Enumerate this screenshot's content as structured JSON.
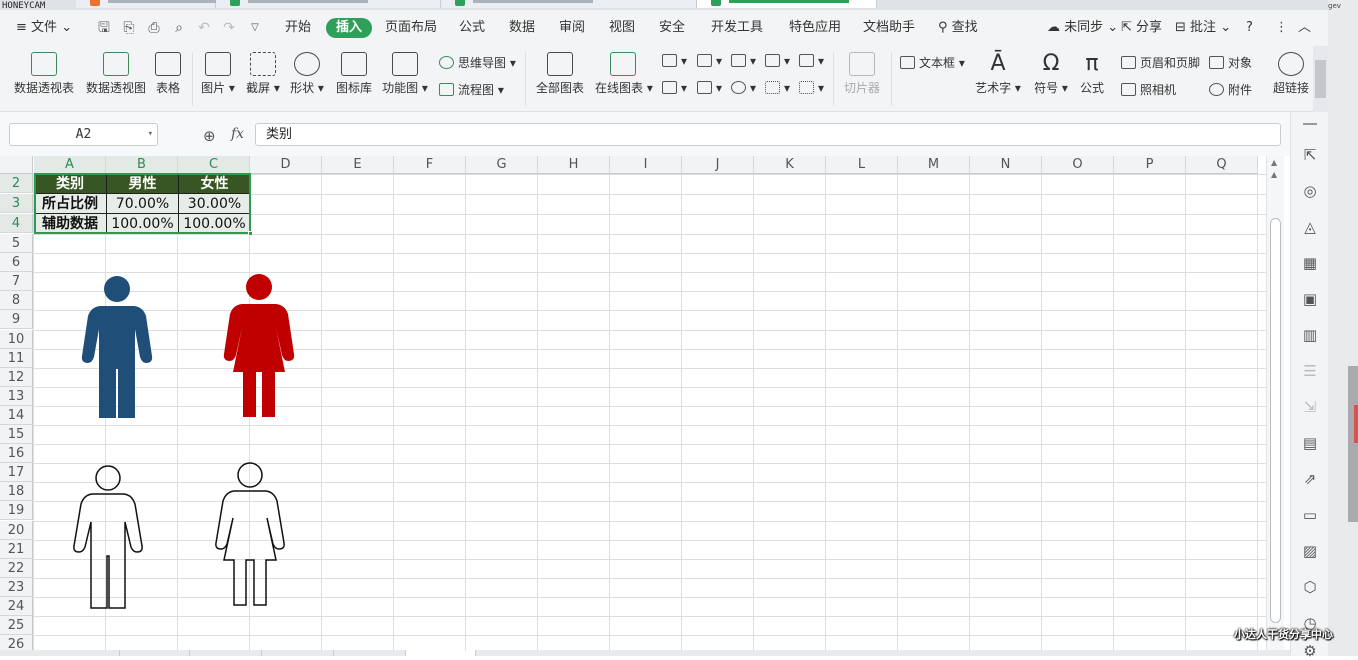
{
  "watermark_top": "HONEYCAM",
  "watermark_bottom": "小达人干货分享中心",
  "menu": {
    "hamburger": "≡",
    "file": "文件",
    "tabs": [
      "开始",
      "插入",
      "页面布局",
      "公式",
      "数据",
      "审阅",
      "视图",
      "安全",
      "开发工具",
      "特色应用",
      "文档助手"
    ],
    "active_tab": "插入",
    "search": "查找",
    "sync": "未同步",
    "share": "分享",
    "comment": "批注",
    "help": "?",
    "more": "⋮",
    "collapse": "︿"
  },
  "ribbon": {
    "pivot_table": "数据透视表",
    "pivot_chart": "数据透视图",
    "table": "表格",
    "picture": "图片",
    "screenshot": "截屏",
    "shape": "形状",
    "icon_lib": "图标库",
    "func_chart": "功能图",
    "mindmap": "思维导图",
    "flowchart": "流程图",
    "all_charts": "全部图表",
    "online_chart": "在线图表",
    "slicer": "切片器",
    "textbox": "文本框",
    "wordart": "艺术字",
    "symbol": "符号",
    "formula": "公式",
    "header_footer": "页眉和页脚",
    "camera": "照相机",
    "object": "对象",
    "attachment": "附件",
    "hyperlink": "超链接"
  },
  "formula_bar": {
    "name_box": "A2",
    "fx": "fx",
    "content": "类别"
  },
  "columns": [
    "A",
    "B",
    "C",
    "D",
    "E",
    "F",
    "G",
    "H",
    "I",
    "J",
    "K",
    "L",
    "M",
    "N",
    "O",
    "P",
    "Q"
  ],
  "rows": [
    "2",
    "3",
    "4",
    "5",
    "6",
    "7",
    "8",
    "9",
    "10",
    "11",
    "12",
    "13",
    "14",
    "15",
    "16",
    "17",
    "18",
    "19",
    "20",
    "21",
    "22",
    "23",
    "24",
    "25",
    "26"
  ],
  "table": {
    "header": [
      "类别",
      "男性",
      "女性"
    ],
    "rows": [
      [
        "所占比例",
        "70.00%",
        "30.00%"
      ],
      [
        "辅助数据",
        "100.00%",
        "100.00%"
      ]
    ]
  },
  "colors": {
    "header_fill": "#375623",
    "male_fill": "#1f4e79",
    "female_fill": "#c00000",
    "active_tab": "#2fa05a",
    "selection": "#2e9a4e"
  }
}
